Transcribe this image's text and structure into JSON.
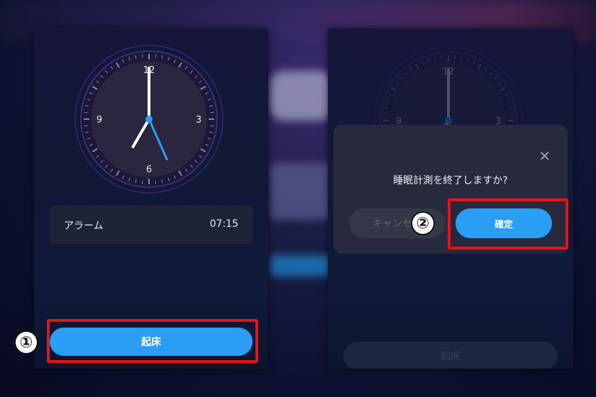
{
  "clock": {
    "numerals": [
      "12",
      "3",
      "6",
      "9"
    ],
    "hour": 7,
    "minute": 0,
    "second": 26
  },
  "screen1": {
    "alarm": {
      "label": "アラーム",
      "time": "07:15"
    },
    "wake_button": "起床",
    "step_badge": "①"
  },
  "screen2": {
    "dialog": {
      "message": "睡眠計測を終了しますか?",
      "cancel_label": "キャンセル",
      "confirm_label": "確定",
      "close_icon": "close-icon"
    },
    "wake_button": "起床",
    "step_badge": "②"
  },
  "colors": {
    "accent": "#2a9df4",
    "highlight": "#ee1111",
    "second_hand": "#2a9df4"
  }
}
